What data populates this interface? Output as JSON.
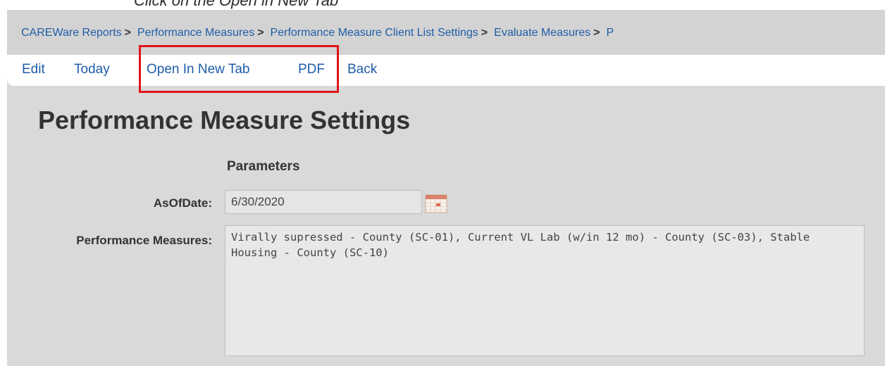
{
  "document": {
    "partial_heading": "Click on the Open in New Tab"
  },
  "breadcrumb": {
    "items": [
      {
        "label": "CAREWare Reports",
        "sep": ">"
      },
      {
        "label": "Performance Measures",
        "sep": ">"
      },
      {
        "label": "Performance Measure Client List Settings",
        "sep": ">"
      },
      {
        "label": "Evaluate Measures",
        "sep": ">"
      },
      {
        "label": "P",
        "sep": ""
      }
    ]
  },
  "menu": {
    "edit": "Edit",
    "today": "Today",
    "open_new_tab": "Open In New Tab",
    "pdf": "PDF",
    "back": "Back"
  },
  "highlight": {
    "color": "#e0141e"
  },
  "page": {
    "title": "Performance Measure Settings"
  },
  "parameters": {
    "heading": "Parameters",
    "as_of_date_label": "AsOfDate:",
    "as_of_date_value": "6/30/2020",
    "measures_label": "Performance Measures:",
    "measures_value": "Virally supressed - County (SC-01), Current VL Lab (w/in 12 mo) - County (SC-03), Stable Housing - County (SC-10)"
  },
  "icons": {
    "calendar": "calendar-icon"
  },
  "colors": {
    "link": "#1f5da8",
    "panel_bg": "#d9d9d9",
    "breadcrumb_bg": "#d3d3d3",
    "text": "#333333"
  }
}
